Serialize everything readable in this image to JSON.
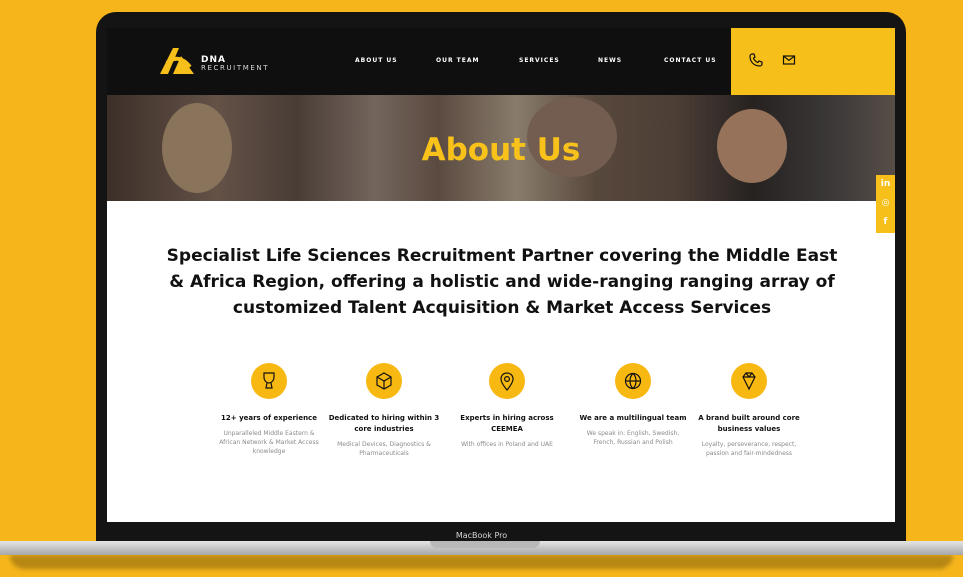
{
  "brand": {
    "name": "DNA",
    "sub": "RECRUITMENT"
  },
  "nav": {
    "links": [
      "ABOUT US",
      "OUR TEAM",
      "SERVICES",
      "NEWS",
      "CONTACT US"
    ],
    "phone_icon": "phone-icon",
    "mail_icon": "mail-icon"
  },
  "hero": {
    "title": "About Us"
  },
  "social": [
    "in",
    "◎",
    "f"
  ],
  "headline": "Specialist Life Sciences Recruitment Partner covering the Middle East & Africa Region, offering a holistic and wide-ranging ranging array of customized Talent Acquisition & Market Access Services",
  "features": [
    {
      "icon": "trophy-icon",
      "title": "12+ years of experience",
      "desc": "Unparalleled Middle Eastern & African Network & Market Access knowledge"
    },
    {
      "icon": "network-icon",
      "title": "Dedicated to hiring within 3 core industries",
      "desc": "Medical Devices, Diagnostics & Pharmaceuticals"
    },
    {
      "icon": "location-pin-icon",
      "title": "Experts in hiring across CEEMEA",
      "desc": "With offices in Poland and UAE"
    },
    {
      "icon": "globe-icon",
      "title": "We are a multilingual team",
      "desc": "We speak in: English, Swedish, French, Russian and Polish"
    },
    {
      "icon": "diamond-icon",
      "title": "A brand built around core business values",
      "desc": "Loyalty, perseverance, respect, passion and fair-mindedness"
    }
  ],
  "device": {
    "model": "MacBook Pro"
  },
  "colors": {
    "accent": "#f7bf1a",
    "background": "#f5b51b",
    "nav": "#0f0f0f"
  }
}
